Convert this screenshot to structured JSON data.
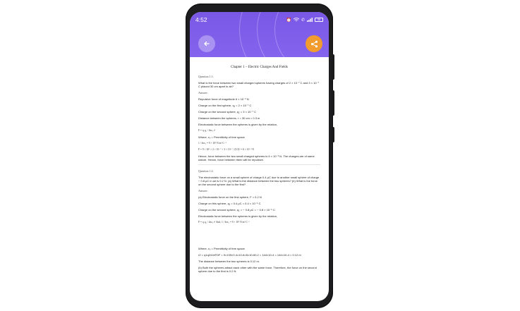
{
  "status": {
    "time": "4:52",
    "battery": "38"
  },
  "chapter_title": "Chapter 1 – Electric Charges And Fields",
  "q1": {
    "heading": "Question 1.1:",
    "question": "What is the force between two small charged spheres having charges of 2 × 10⁻⁷ C and 3 × 10⁻⁷ C placed 30 cm apart in air?",
    "answer_label": "Answer:",
    "lines": [
      "Repulsive force of magnitude 6 × 10⁻³ N",
      "Charge on the first sphere, q₁ = 2 × 10⁻⁷ C",
      "Charge on the second sphere, q₂ = 3 × 10⁻⁷ C",
      "Distance between the spheres, r = 30 cm = 0.3 m",
      "Electrostatic force between the spheres is given by the relation,"
    ],
    "formula1": "F = q₁q₂ / 4πε₀ r²",
    "where": "Where, ε₀ = Permittivity of free space",
    "formula2": "1 / 4πε₀ = 9 × 10⁹ N m² C⁻²",
    "formula3": "F = 9 × 10⁹ × 2 × 10⁻⁷ × 3 × 10⁻⁷ / (0.3)² = 6 × 10⁻³ N",
    "conclusion": "Hence, force between the two small charged spheres is 6 × 10⁻³ N. The charges are of same nature. Hence, force between them will be repulsive."
  },
  "q2": {
    "heading": "Question 1.2:",
    "question": "The electrostatic force on a small sphere of charge 0.4 μC due to another small sphere of charge − 0.8 μC in air is 0.2 N. (a) What is the distance between the two spheres? (b) What is the force on the second sphere due to the first?",
    "answer_label": "Answer:",
    "lines": [
      "(a) Electrostatic force on the first sphere, F = 0.2 N",
      "Charge on this sphere, q₁ = 0.4 μC = 0.4 × 10⁻⁶ C",
      "Charge on the second sphere, q₂ = − 0.8 μC = − 0.8 × 10⁻⁶ C",
      "Electrostatic force between the spheres is given by the relation,"
    ],
    "formula1": "F = q₁q₂ / 4πε₀ r²   And,   1 / 4πε₀ = 9 × 10⁹ N m² C⁻²",
    "where": "Where, ε₀ = Permittivity of free space",
    "calc": "r2 = q1q2/4π∈0F    = 9×109×0.4×10-6×8×10-60.2    = 144×10-4   = 144×10-4 = 0.12 m",
    "distance": "The distance between the two spheres is 0.12 m.",
    "part_b": "(b) Both the spheres attract each other with the same force. Therefore, the force on the second sphere due to the first is 0.2 N."
  }
}
